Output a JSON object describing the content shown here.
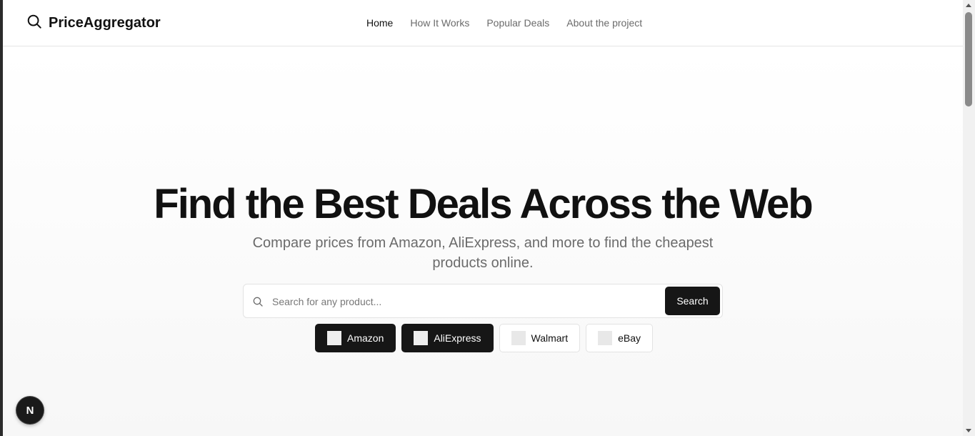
{
  "header": {
    "brand": "PriceAggregator",
    "brand_icon": "search-icon",
    "nav": [
      "Home",
      "How It Works",
      "Popular Deals",
      "About the project"
    ],
    "active_nav": "Home"
  },
  "hero": {
    "title": "Find the Best Deals Across the Web",
    "subtitle": "Compare prices from Amazon, AliExpress, and more to find the cheapest products online."
  },
  "search": {
    "placeholder": "Search for any product...",
    "value": "",
    "button_label": "Search"
  },
  "stores": [
    {
      "label": "Amazon",
      "selected": true
    },
    {
      "label": "AliExpress",
      "selected": true
    },
    {
      "label": "Walmart",
      "selected": false
    },
    {
      "label": "eBay",
      "selected": false
    }
  ],
  "dev_badge": "N",
  "colors": {
    "primary": "#161616",
    "muted_text": "#6b6b6b",
    "border": "#e3e3e3"
  }
}
